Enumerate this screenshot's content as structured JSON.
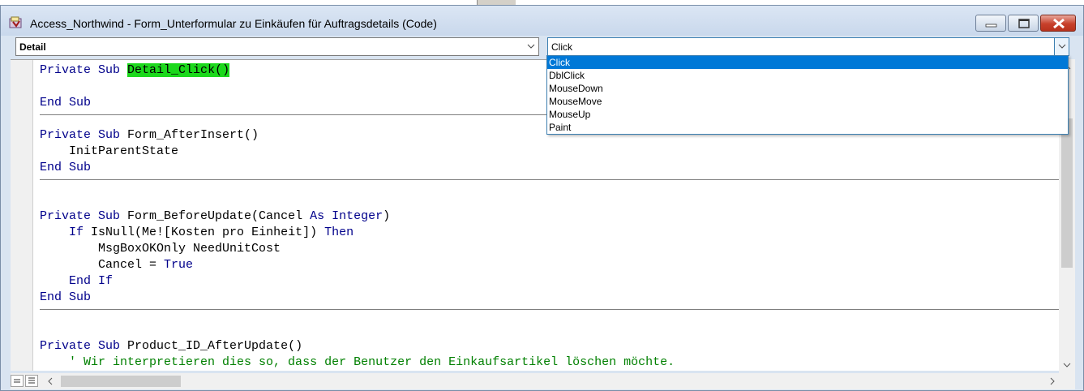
{
  "window": {
    "title": "Access_Northwind - Form_Unterformular zu Einkäufen für Auftragsdetails (Code)"
  },
  "object_combo": {
    "value": "Detail"
  },
  "procedure_combo": {
    "value": "Click",
    "options": [
      "Click",
      "DblClick",
      "MouseDown",
      "MouseMove",
      "MouseUp",
      "Paint"
    ],
    "selected": "Click"
  },
  "code": {
    "l1_kw": "Private Sub",
    "l1_name": "Detail_Click()",
    "l2": "End Sub",
    "l3_kw": "Private Sub",
    "l3_rest": " Form_AfterInsert()",
    "l4": "    InitParentState",
    "l5": "End Sub",
    "l6_kw": "Private Sub",
    "l6_rest1": " Form_BeforeUpdate(Cancel ",
    "l6_as": "As",
    "l6_sp": " ",
    "l6_int": "Integer",
    "l6_close": ")",
    "l7_indent": "    ",
    "l7_if": "If",
    "l7_mid": " IsNull(Me![Kosten pro Einheit]) ",
    "l7_then": "Then",
    "l8": "        MsgBoxOKOnly NeedUnitCost",
    "l9_pre": "        Cancel = ",
    "l9_true": "True",
    "l10_indent": "    ",
    "l10_endif": "End If",
    "l11": "End Sub",
    "l12_kw": "Private Sub",
    "l12_rest": " Product_ID_AfterUpdate()",
    "l13_indent": "    ",
    "l13_comment": "' Wir interpretieren dies so, dass der Benutzer den Einkaufsartikel löschen möchte."
  },
  "colors": {
    "keyword": "#00008b",
    "comment": "#008000",
    "highlight": "#1cd81c",
    "selection": "#0078d7"
  }
}
